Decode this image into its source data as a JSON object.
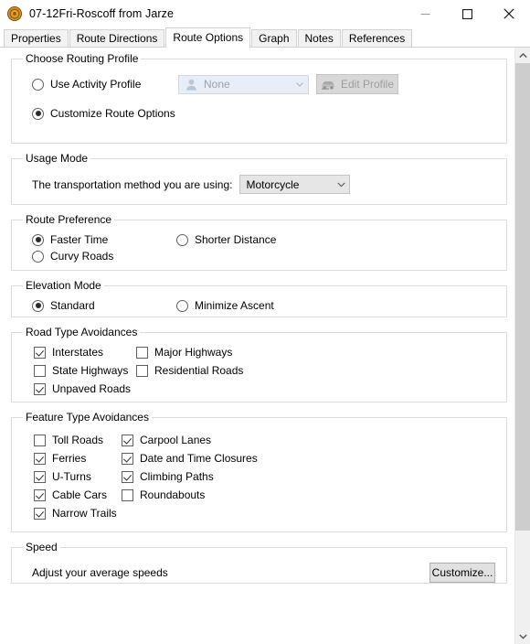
{
  "window": {
    "title": "07-12Fri-Roscoff from Jarze",
    "icon": "route-target-icon",
    "controls": [
      {
        "name": "minimize-button",
        "glyph": "minimize"
      },
      {
        "name": "maximize-button",
        "glyph": "maximize"
      },
      {
        "name": "close-button",
        "glyph": "close"
      }
    ]
  },
  "tabs": [
    {
      "label": "Properties",
      "active": false
    },
    {
      "label": "Route Directions",
      "active": false
    },
    {
      "label": "Route Options",
      "active": true
    },
    {
      "label": "Graph",
      "active": false
    },
    {
      "label": "Notes",
      "active": false
    },
    {
      "label": "References",
      "active": false
    }
  ],
  "routing_profile": {
    "legend": "Choose Routing Profile",
    "use_activity_profile": {
      "label": "Use Activity Profile",
      "checked": false
    },
    "customize_route_options": {
      "label": "Customize Route Options",
      "checked": true
    },
    "profile_combo": {
      "value": "None",
      "disabled": true
    },
    "edit_profile_button": {
      "label": "Edit Profile",
      "disabled": true
    }
  },
  "usage_mode": {
    "legend": "Usage Mode",
    "field_label": "The transportation method you are using:",
    "transportation_combo": {
      "value": "Motorcycle",
      "disabled": false
    }
  },
  "route_preference": {
    "legend": "Route Preference",
    "options": [
      {
        "label": "Faster Time",
        "checked": true
      },
      {
        "label": "Shorter Distance",
        "checked": false
      },
      {
        "label": "Curvy Roads",
        "checked": false
      }
    ]
  },
  "elevation_mode": {
    "legend": "Elevation Mode",
    "options": [
      {
        "label": "Standard",
        "checked": true
      },
      {
        "label": "Minimize Ascent",
        "checked": false
      }
    ]
  },
  "road_type_avoidances": {
    "legend": "Road Type Avoidances",
    "items": [
      {
        "label": "Interstates",
        "checked": true
      },
      {
        "label": "Major Highways",
        "checked": false
      },
      {
        "label": "State Highways",
        "checked": false
      },
      {
        "label": "Residential Roads",
        "checked": false
      },
      {
        "label": "Unpaved Roads",
        "checked": true
      }
    ]
  },
  "feature_type_avoidances": {
    "legend": "Feature Type Avoidances",
    "items": [
      {
        "label": "Toll Roads",
        "checked": false
      },
      {
        "label": "Carpool Lanes",
        "checked": true
      },
      {
        "label": "Ferries",
        "checked": true
      },
      {
        "label": "Date and Time Closures",
        "checked": true
      },
      {
        "label": "U-Turns",
        "checked": true
      },
      {
        "label": "Climbing Paths",
        "checked": true
      },
      {
        "label": "Cable Cars",
        "checked": true
      },
      {
        "label": "Roundabouts",
        "checked": false
      },
      {
        "label": "Narrow Trails",
        "checked": true
      }
    ]
  },
  "speed": {
    "legend": "Speed",
    "description": "Adjust your average speeds",
    "customize_button": {
      "label": "Customize..."
    }
  },
  "scrollbar": {
    "up_arrow": "chevron-up-icon",
    "down_arrow": "chevron-down-icon"
  },
  "colors": {
    "window_bg": "#ffffff",
    "group_border": "#dcdcdc",
    "tab_inactive_bg": "#f2f2f2",
    "tab_active_bg": "#ffffff",
    "combo_bg": "#e6e6e6",
    "combo_disabled_bg": "#e8eef8",
    "button_bg": "#e1e1e1",
    "scroll_track": "#f0f0f0",
    "scroll_thumb": "#cdcdcd",
    "app_icon_accent": "#e09820"
  }
}
